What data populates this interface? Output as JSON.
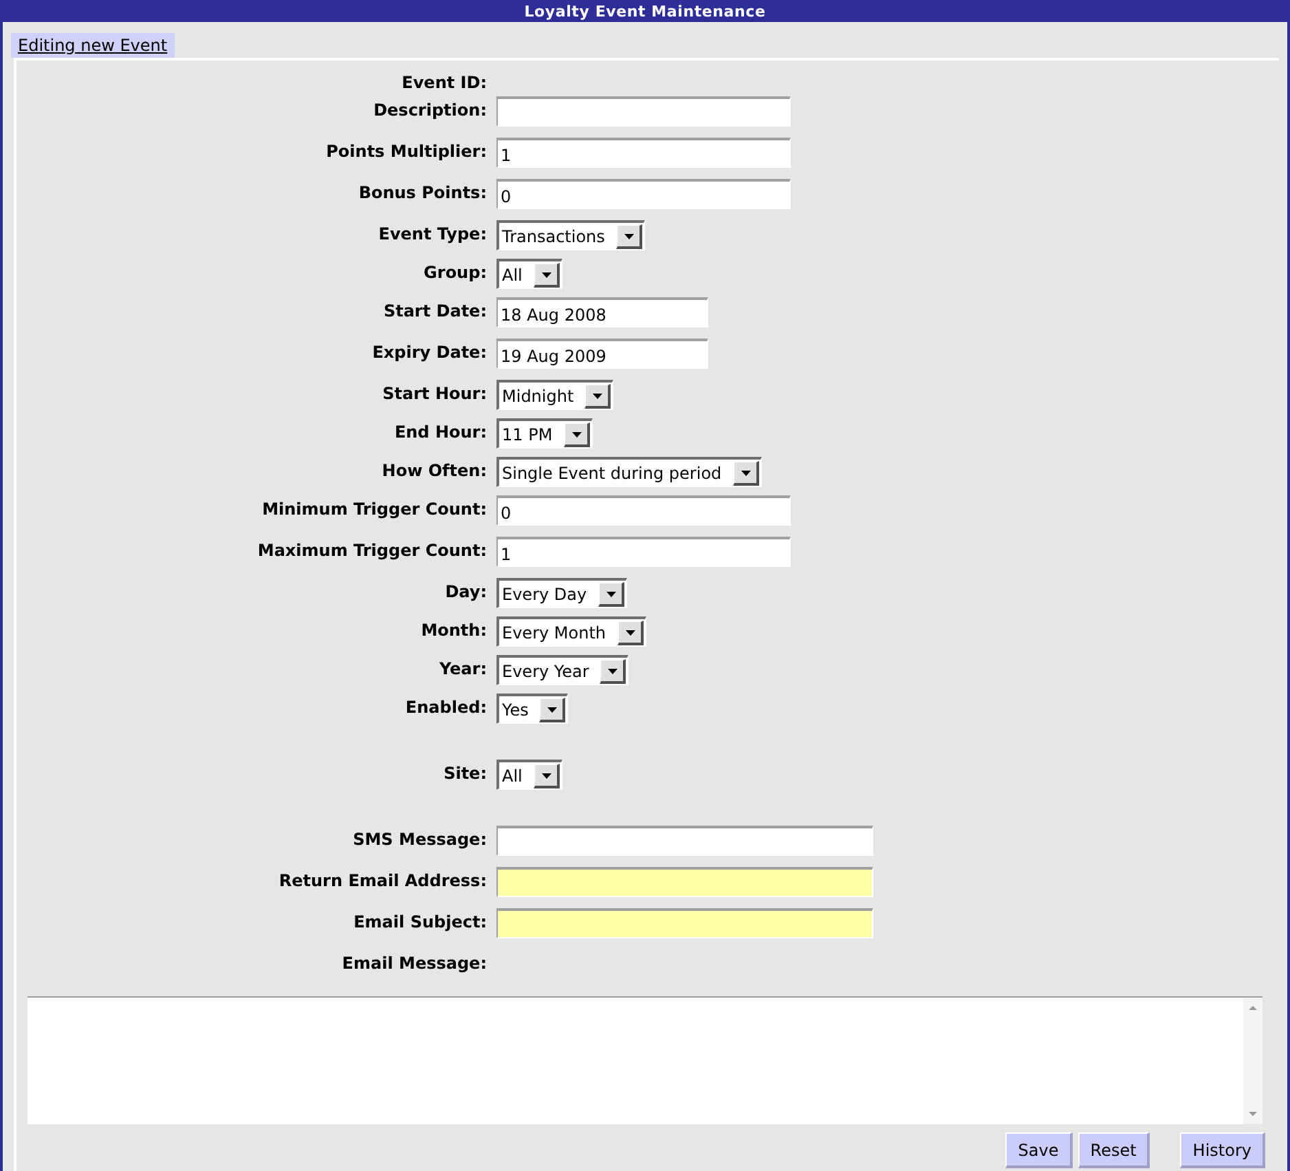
{
  "window": {
    "title": "Loyalty Event Maintenance"
  },
  "tabs": [
    {
      "label": "Editing new Event",
      "selected": true
    }
  ],
  "sections": [
    [
      {
        "label": "Event ID:",
        "kind": "static"
      },
      {
        "label": "Description:",
        "kind": "text"
      },
      {
        "label": "Points Multiplier:",
        "kind": "text",
        "value": "1"
      },
      {
        "label": "Bonus Points:",
        "kind": "text",
        "value": "0"
      },
      {
        "label": "Event Type:",
        "kind": "select",
        "value": "Transactions"
      },
      {
        "label": "Group:",
        "kind": "select",
        "value": "All"
      },
      {
        "label": "Start Date:",
        "kind": "date",
        "value": "18 Aug 2008"
      },
      {
        "label": "Expiry Date:",
        "kind": "date",
        "value": "19 Aug 2009"
      },
      {
        "label": "Start Hour:",
        "kind": "select",
        "value": "Midnight"
      },
      {
        "label": "End Hour:",
        "kind": "select",
        "value": "11 PM"
      },
      {
        "label": "How Often:",
        "kind": "select",
        "value": "Single Event during period"
      },
      {
        "label": "Minimum Trigger Count:",
        "kind": "text",
        "value": "0"
      },
      {
        "label": "Maximum Trigger Count:",
        "kind": "text",
        "value": "1"
      },
      {
        "label": "Day:",
        "kind": "select",
        "value": "Every Day"
      },
      {
        "label": "Month:",
        "kind": "select",
        "value": "Every Month"
      },
      {
        "label": "Year:",
        "kind": "select",
        "value": "Every Year"
      },
      {
        "label": "Enabled:",
        "kind": "select",
        "value": "Yes"
      }
    ],
    [
      {
        "label": "Site:",
        "kind": "select",
        "value": "All"
      }
    ],
    [
      {
        "label": "SMS Message:",
        "kind": "wide",
        "required": false
      },
      {
        "label": "Return Email Address:",
        "kind": "wide",
        "required": true
      },
      {
        "label": "Email Subject:",
        "kind": "wide",
        "required": true
      },
      {
        "label": "Email Message:",
        "kind": "static"
      }
    ]
  ],
  "buttons": [
    "Save",
    "Reset",
    "History"
  ]
}
